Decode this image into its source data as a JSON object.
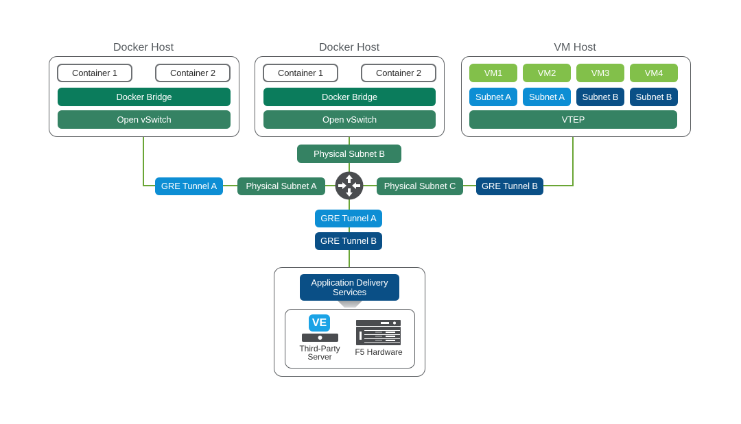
{
  "hosts": [
    {
      "title": "Docker Host",
      "containers": [
        "Container 1",
        "Container 2"
      ],
      "bridge": "Docker Bridge",
      "switch": "Open vSwitch"
    },
    {
      "title": "Docker Host",
      "containers": [
        "Container 1",
        "Container 2"
      ],
      "bridge": "Docker Bridge",
      "switch": "Open vSwitch"
    },
    {
      "title": "VM Host",
      "vms": [
        "VM1",
        "VM2",
        "VM3",
        "VM4"
      ],
      "subnets": [
        "Subnet A",
        "Subnet A",
        "Subnet B",
        "Subnet B"
      ],
      "vtep": "VTEP"
    }
  ],
  "network": {
    "physical_subnet_a": "Physical Subnet A",
    "physical_subnet_b": "Physical Subnet B",
    "physical_subnet_c": "Physical Subnet C",
    "gre_tunnel_a_left": "GRE Tunnel A",
    "gre_tunnel_b_right": "GRE Tunnel B",
    "gre_tunnel_a_bottom": "GRE Tunnel A",
    "gre_tunnel_b_bottom": "GRE Tunnel B",
    "router_icon": "router-icon"
  },
  "services": {
    "title": "Application Delivery Services",
    "third_party": "Third-Party Server",
    "ve_badge": "VE",
    "hardware": "F5 Hardware"
  },
  "colors": {
    "docker_bridge": "#0b7c5c",
    "open_vswitch": "#358263",
    "vm": "#82c04a",
    "subnet_a": "#0d8ed4",
    "subnet_b": "#0a4f86",
    "wire": "#6aa535",
    "router": "#4a4c4f"
  }
}
